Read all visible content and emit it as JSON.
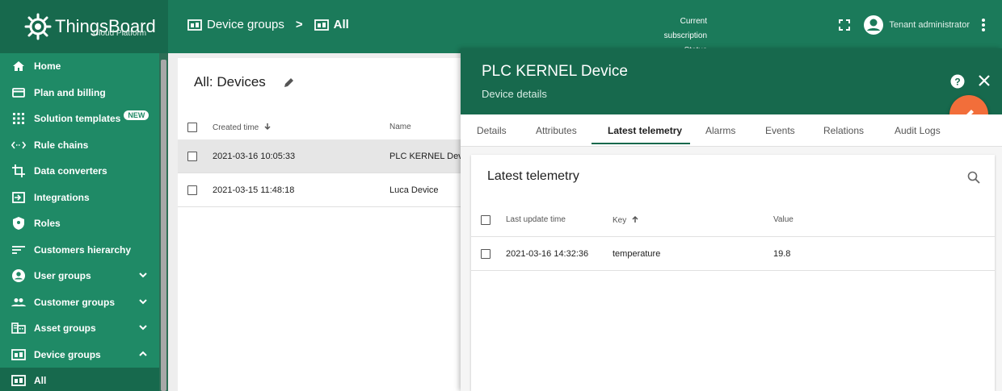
{
  "app": {
    "logo_title": "ThingsBoard",
    "logo_subtitle": "Cloud Platform"
  },
  "breadcrumb": {
    "first": "Device groups",
    "separator": ">",
    "last": "All"
  },
  "header": {
    "subscription_line1": "Current subscription",
    "subscription_line2": "Status",
    "user_name": "Tenant administrator"
  },
  "sidebar": {
    "items": [
      {
        "label": "Home",
        "icon": "home-icon"
      },
      {
        "label": "Plan and billing",
        "icon": "billing-icon"
      },
      {
        "label": "Solution templates",
        "icon": "grid-icon",
        "badge": "NEW"
      },
      {
        "label": "Rule chains",
        "icon": "code-icon"
      },
      {
        "label": "Data converters",
        "icon": "converter-icon"
      },
      {
        "label": "Integrations",
        "icon": "integration-icon"
      },
      {
        "label": "Roles",
        "icon": "shield-icon"
      },
      {
        "label": "Customers hierarchy",
        "icon": "hierarchy-icon"
      },
      {
        "label": "User groups",
        "icon": "account-icon"
      },
      {
        "label": "Customer groups",
        "icon": "people-icon"
      },
      {
        "label": "Asset groups",
        "icon": "domain-icon"
      },
      {
        "label": "Device groups",
        "icon": "devices-icon"
      },
      {
        "label": "All",
        "icon": "devices-icon"
      }
    ]
  },
  "devices": {
    "title": "All: Devices",
    "columns": {
      "created": "Created time",
      "name": "Name"
    },
    "rows": [
      {
        "created": "2021-03-16 10:05:33",
        "name": "PLC KERNEL Device"
      },
      {
        "created": "2021-03-15 11:48:18",
        "name": "Luca Device"
      }
    ]
  },
  "drawer": {
    "title": "PLC KERNEL Device",
    "subtitle": "Device details",
    "tabs": [
      "Details",
      "Attributes",
      "Latest telemetry",
      "Alarms",
      "Events",
      "Relations",
      "Audit Logs"
    ],
    "active_tab": "Latest telemetry"
  },
  "telemetry": {
    "title": "Latest telemetry",
    "columns": {
      "time": "Last update time",
      "key": "Key",
      "value": "Value"
    },
    "rows": [
      {
        "time": "2021-03-16 14:32:36",
        "key": "temperature",
        "value": "19.8"
      }
    ]
  },
  "colors": {
    "header_green": "#17694d",
    "sidebar_green": "#1f8a66",
    "fab_orange": "#f26e3a"
  }
}
